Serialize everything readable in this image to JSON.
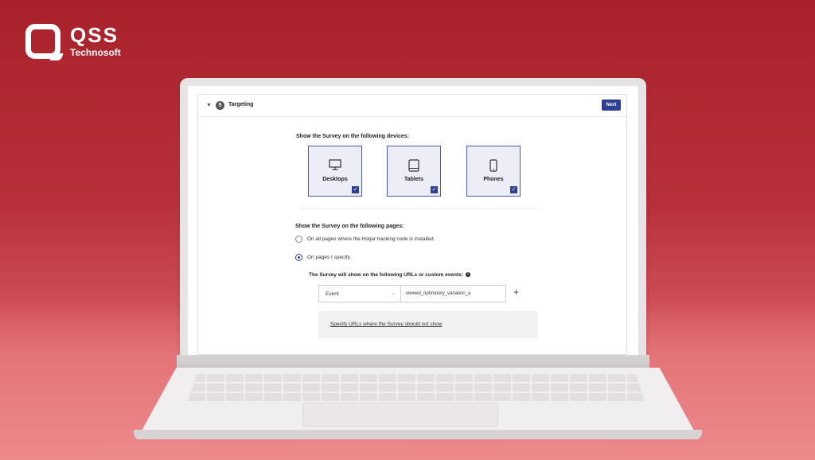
{
  "brand": {
    "name": "QSS",
    "subtitle": "Technosoft",
    "color": "#ffffff"
  },
  "colors": {
    "background": "#b8313a",
    "accent": "#2f3f95",
    "device_fill": "#ecedf7"
  },
  "section": {
    "step_number": "5",
    "title": "Targeting",
    "next_label": "Next",
    "collapse_icon": "caret-down-icon"
  },
  "devices": {
    "heading": "Show the Survey on the following devices:",
    "items": [
      {
        "label": "Desktops",
        "icon": "desktop-icon",
        "checked": true
      },
      {
        "label": "Tablets",
        "icon": "tablet-icon",
        "checked": true
      },
      {
        "label": "Phones",
        "icon": "phone-icon",
        "checked": true
      }
    ]
  },
  "pages": {
    "heading": "Show the Survey on the following pages:",
    "options": [
      {
        "label": "On all pages where the Hotjar tracking code is installed.",
        "selected": false
      },
      {
        "label": "On pages I specify.",
        "selected": true
      }
    ],
    "rules_heading": "The Survey will show on the following URLs or custom events:",
    "rule": {
      "type": "Event",
      "value": "viewed_optimizely_variation_a"
    },
    "exclude_link": "Specify URLs where the Survey should not show"
  }
}
